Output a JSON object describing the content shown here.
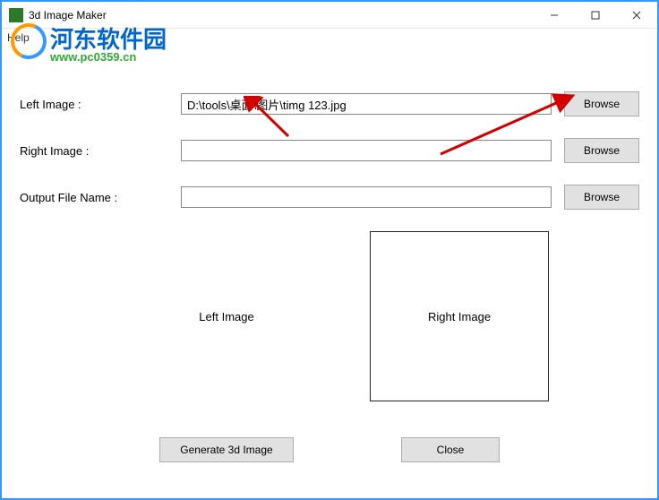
{
  "window": {
    "title": "3d Image Maker"
  },
  "menu": {
    "help": "Help"
  },
  "watermark": {
    "cn": "河东软件园",
    "url": "www.pc0359.cn"
  },
  "form": {
    "left_image_label": "Left Image :",
    "left_image_value": "D:\\tools\\桌面\\图片\\timg 123.jpg",
    "right_image_label": "Right Image :",
    "right_image_value": "",
    "output_label": "Output File Name :",
    "output_value": "",
    "browse_label": "Browse"
  },
  "preview": {
    "left_label": "Left Image",
    "right_label": "Right Image"
  },
  "actions": {
    "generate": "Generate 3d Image",
    "close": "Close"
  }
}
